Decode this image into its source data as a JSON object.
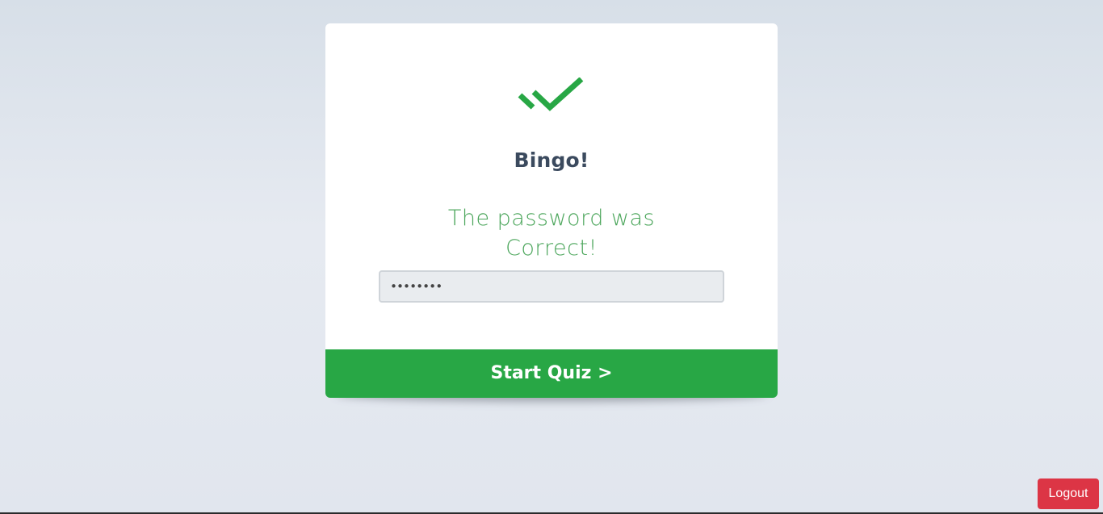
{
  "card": {
    "icon": "double-check-icon",
    "title": "Bingo!",
    "message_line1": "The password was",
    "message_line2": "Correct!",
    "password_value": "••••••••",
    "start_button_label": "Start Quiz >"
  },
  "logout_label": "Logout",
  "colors": {
    "success": "#28a745",
    "message_text": "#4aa55a",
    "title_text": "#3b4a5e",
    "danger": "#dc3545",
    "field_bg": "#e9ecef"
  }
}
